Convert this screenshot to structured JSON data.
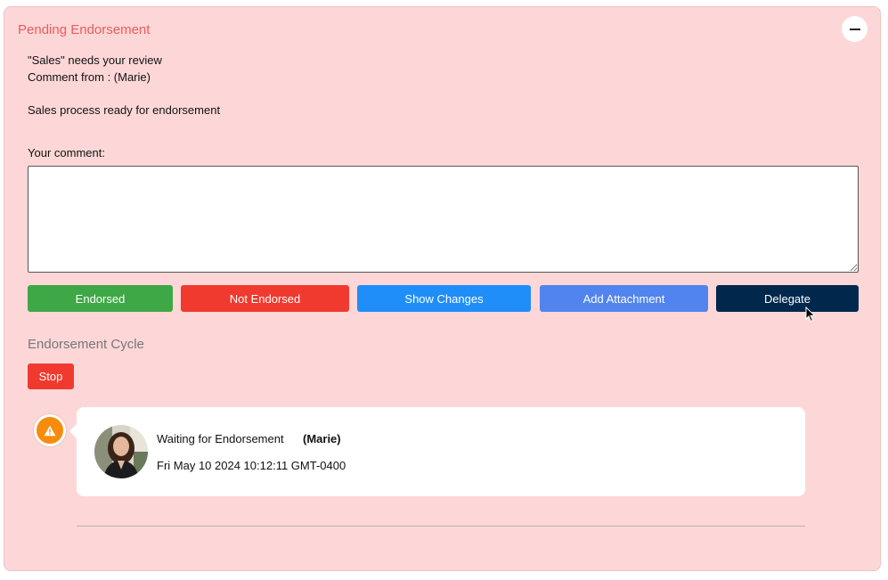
{
  "panel": {
    "title": "Pending Endorsement",
    "collapse_icon": "minus-icon"
  },
  "review": {
    "line1": "\"Sales\" needs your review",
    "line2": "Comment from : (Marie)",
    "message": "Sales process ready for endorsement"
  },
  "comment": {
    "label": "Your comment:",
    "value": "",
    "placeholder": ""
  },
  "actions": {
    "endorsed": "Endorsed",
    "not_endorsed": "Not Endorsed",
    "show_changes": "Show Changes",
    "add_attachment": "Add Attachment",
    "delegate": "Delegate"
  },
  "cycle": {
    "title": "Endorsement Cycle",
    "stop_label": "Stop",
    "entries": [
      {
        "status_icon": "warning-icon",
        "status": "Waiting for Endorsement",
        "name": "(Marie)",
        "date": "Fri May 10 2024 10:12:11 GMT-0400"
      }
    ]
  },
  "colors": {
    "panel_bg": "#fdd7d8",
    "title": "#ee5a5c",
    "endorsed": "#3fa846",
    "not_endorsed": "#f03a2f",
    "show_changes": "#1f8ef9",
    "add_attachment": "#5184ee",
    "delegate": "#00274c",
    "stop": "#f03a2f",
    "warning": "#f78c0c"
  }
}
